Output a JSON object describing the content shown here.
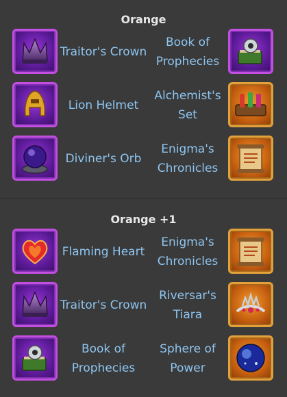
{
  "sections": [
    {
      "title": "Orange",
      "rows": [
        {
          "left": {
            "name": "Traitor's Crown",
            "icon": "crown-icon"
          },
          "right": {
            "name": "Book of Prophecies",
            "icon": "book-icon"
          }
        },
        {
          "left": {
            "name": "Lion Helmet",
            "icon": "helmet-icon"
          },
          "right": {
            "name": "Alchemist's Set",
            "icon": "potion-set-icon"
          }
        },
        {
          "left": {
            "name": "Diviner's Orb",
            "icon": "orb-icon"
          },
          "right": {
            "name": "Enigma's Chronicles",
            "icon": "scroll-icon"
          }
        }
      ]
    },
    {
      "title": "Orange +1",
      "rows": [
        {
          "left": {
            "name": "Flaming Heart",
            "icon": "heart-icon"
          },
          "right": {
            "name": "Enigma's Chronicles",
            "icon": "scroll-icon"
          }
        },
        {
          "left": {
            "name": "Traitor's Crown",
            "icon": "crown-icon"
          },
          "right": {
            "name": "Riversar's Tiara",
            "icon": "tiara-icon"
          }
        },
        {
          "left": {
            "name": "Book of Prophecies",
            "icon": "book-icon"
          },
          "right": {
            "name": "Sphere of Power",
            "icon": "sphere-icon"
          }
        }
      ]
    }
  ],
  "colors": {
    "background": "#3a3a3a",
    "item_text": "#8ec5f0",
    "header_text": "#e8e8e8",
    "purple_frame": "#c24fe0",
    "orange_frame": "#e3a13b"
  }
}
